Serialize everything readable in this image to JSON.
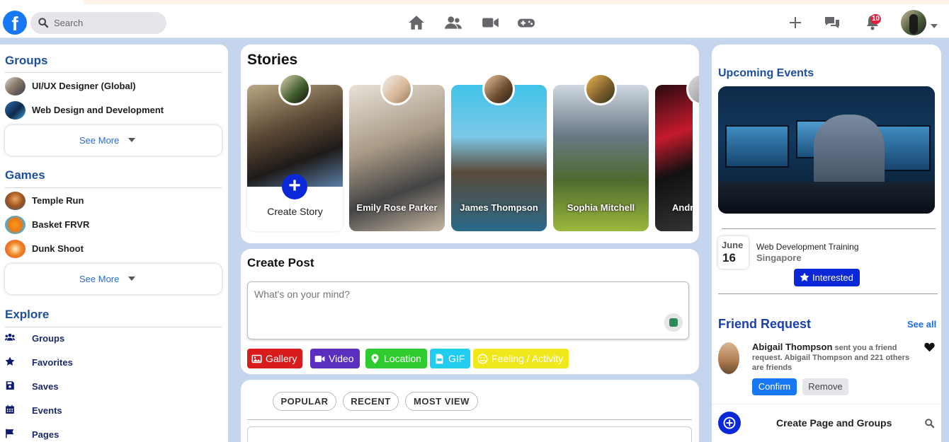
{
  "navbar": {
    "logo": "f",
    "search_placeholder": "Search",
    "nav_icons": [
      "home-icon",
      "friends-icon",
      "video-icon",
      "gaming-icon"
    ],
    "right_icons": [
      "plus-icon",
      "messenger-icon",
      "bell-icon"
    ],
    "notification_count": "10"
  },
  "sidebar": {
    "groups_title": "Groups",
    "groups": [
      {
        "label": "UI/UX Designer (Global)"
      },
      {
        "label": "Web Design and Development"
      }
    ],
    "groups_see_more": "See More",
    "games_title": "Games",
    "games": [
      {
        "label": "Temple Run"
      },
      {
        "label": "Basket FRVR"
      },
      {
        "label": "Dunk Shoot"
      }
    ],
    "games_see_more": "See More",
    "explore_title": "Explore",
    "explore": [
      {
        "label": "Groups",
        "icon": "users-icon"
      },
      {
        "label": "Favorites",
        "icon": "star-icon"
      },
      {
        "label": "Saves",
        "icon": "save-icon"
      },
      {
        "label": "Events",
        "icon": "calendar-icon"
      },
      {
        "label": "Pages",
        "icon": "flag-icon"
      }
    ]
  },
  "stories": {
    "title": "Stories",
    "create_label": "Create Story",
    "items": [
      {
        "name": "Emily Rose Parker"
      },
      {
        "name": "James Thompson"
      },
      {
        "name": "Sophia Mitchell"
      },
      {
        "name": "Andr"
      }
    ]
  },
  "create_post": {
    "title": "Create Post",
    "placeholder": "What's on your mind?",
    "actions": [
      {
        "label": "Gallery",
        "color": "#d81b1b"
      },
      {
        "label": "Video",
        "color": "#5a2fc0"
      },
      {
        "label": "Location",
        "color": "#2ecc2e"
      },
      {
        "label": "GIF",
        "color": "#22ccee"
      },
      {
        "label": "Feeling / Activity",
        "color": "#f1e81b"
      }
    ]
  },
  "feed": {
    "tabs": [
      "POPULAR",
      "RECENT",
      "MOST VIEW"
    ]
  },
  "events": {
    "title": "Upcoming Events",
    "month": "June",
    "day": "16",
    "name": "Web Development Training",
    "location": "Singapore",
    "interested_label": "Interested"
  },
  "friend_request": {
    "title": "Friend Request",
    "see_all": "See all",
    "name": "Abigail Thompson",
    "text": "sent you a friend request. Abigail Thompson and 221 others are friends",
    "confirm_label": "Confirm",
    "remove_label": "Remove"
  },
  "footer": {
    "create_label": "Create Page and Groups"
  },
  "colors": {
    "accent": "#1877f2",
    "brand_blue": "#0a28d8",
    "section_title": "#1c4f9c",
    "background": "#c6d5ee"
  }
}
